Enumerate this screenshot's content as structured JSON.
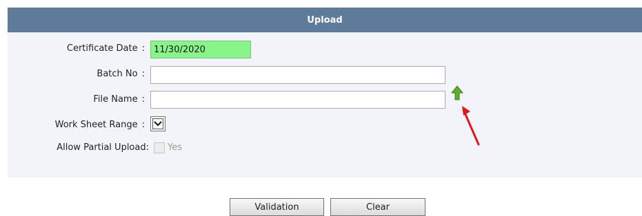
{
  "header": {
    "title": "Upload"
  },
  "form": {
    "certificate_date": {
      "label": "Certificate Date",
      "value": "11/30/2020"
    },
    "batch_no": {
      "label": "Batch No",
      "value": ""
    },
    "file_name": {
      "label": "File Name",
      "value": ""
    },
    "work_sheet_range": {
      "label": "Work Sheet Range",
      "value": ""
    },
    "allow_partial_upload": {
      "label": "Allow Partial Upload:",
      "option_label": "Yes",
      "checked": false,
      "disabled": true
    },
    "colon": ":"
  },
  "icons": {
    "upload": "upload-arrow-icon",
    "annotation": "red-arrow-annotation-icon"
  },
  "colors": {
    "header_bg": "#5f7b9b",
    "date_bg": "#87f587",
    "panel_bg": "#f3f4f9",
    "upload_icon": "#5fae2a",
    "annotation": "#e0161b"
  },
  "buttons": {
    "validation": "Validation",
    "clear": "Clear"
  }
}
